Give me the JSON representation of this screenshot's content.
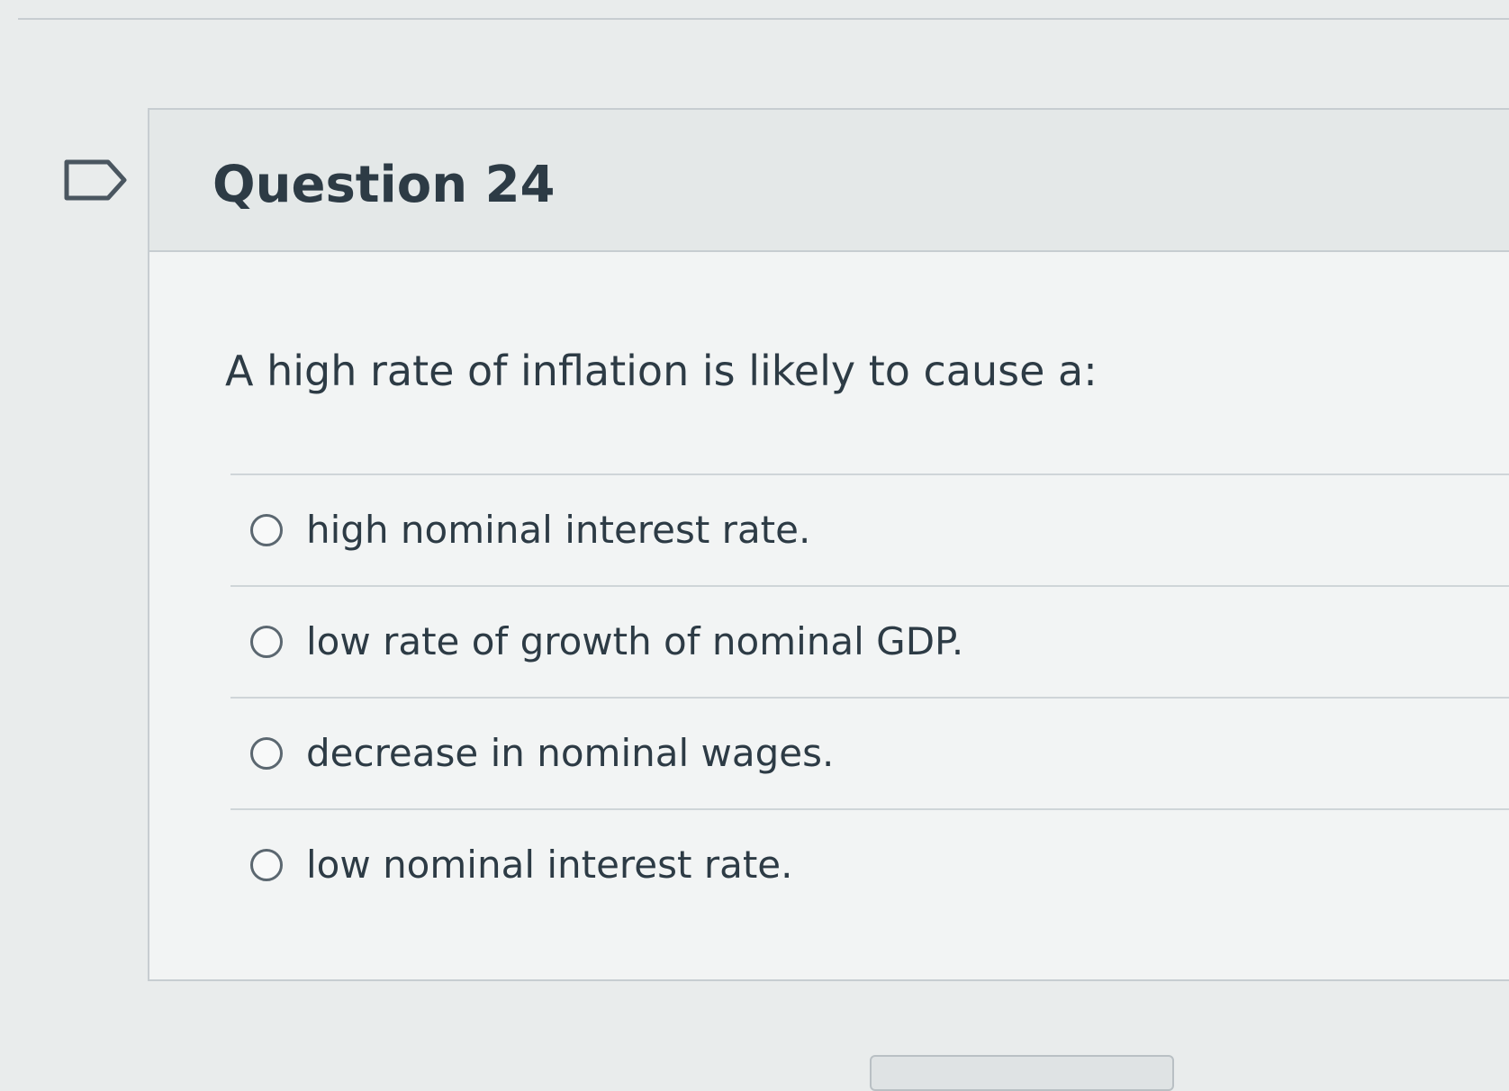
{
  "question": {
    "title": "Question 24",
    "prompt": "A high rate of inflation is likely to cause a:",
    "flag_icon": "flag-outline-icon",
    "answers": [
      {
        "label": "high nominal interest rate.",
        "selected": false
      },
      {
        "label": "low rate of growth of nominal GDP.",
        "selected": false
      },
      {
        "label": "decrease in nominal wages.",
        "selected": false
      },
      {
        "label": "low nominal interest rate.",
        "selected": false
      }
    ]
  },
  "colors": {
    "text": "#2d3b45",
    "border": "#c7cdd1",
    "header_bg": "#e4e8e8",
    "card_bg": "#f2f4f4"
  }
}
